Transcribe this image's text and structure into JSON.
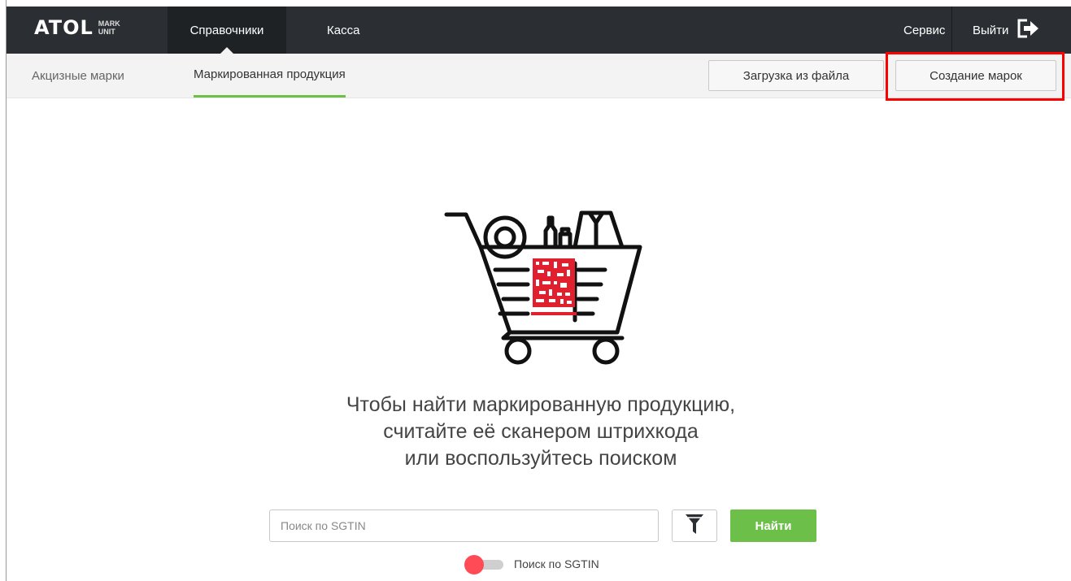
{
  "header": {
    "logo_text": "ATOL",
    "logo_sub_line1": "MARK",
    "logo_sub_line2": "UNIT",
    "nav_items": [
      "Справочники",
      "Касса"
    ],
    "service_label": "Сервис",
    "logout_label": "Выйти"
  },
  "subnav": {
    "tabs": [
      "Акцизные марки",
      "Маркированная продукция"
    ],
    "active_tab": "Маркированная продукция",
    "upload_button": "Загрузка из файла",
    "create_button": "Создание марок"
  },
  "empty_state": {
    "line1": "Чтобы найти маркированную продукцию,",
    "line2": "считайте её сканером штрихкода",
    "line3": "или воспользуйтесь поиском"
  },
  "search": {
    "placeholder": "Поиск по SGTIN",
    "value": "",
    "find_button": "Найти",
    "toggle_label": "Поиск по SGTIN",
    "toggle_on": false
  },
  "colors": {
    "topbar": "#2b2f33",
    "accent_green": "#6cc04a",
    "highlight_red": "#ff0000",
    "toggle_knob": "#ff4b55",
    "code_red": "#e0202e"
  },
  "icons": {
    "logout": "logout-icon",
    "filter": "filter-icon",
    "illustration": "shopping-cart-datamatrix-icon"
  }
}
